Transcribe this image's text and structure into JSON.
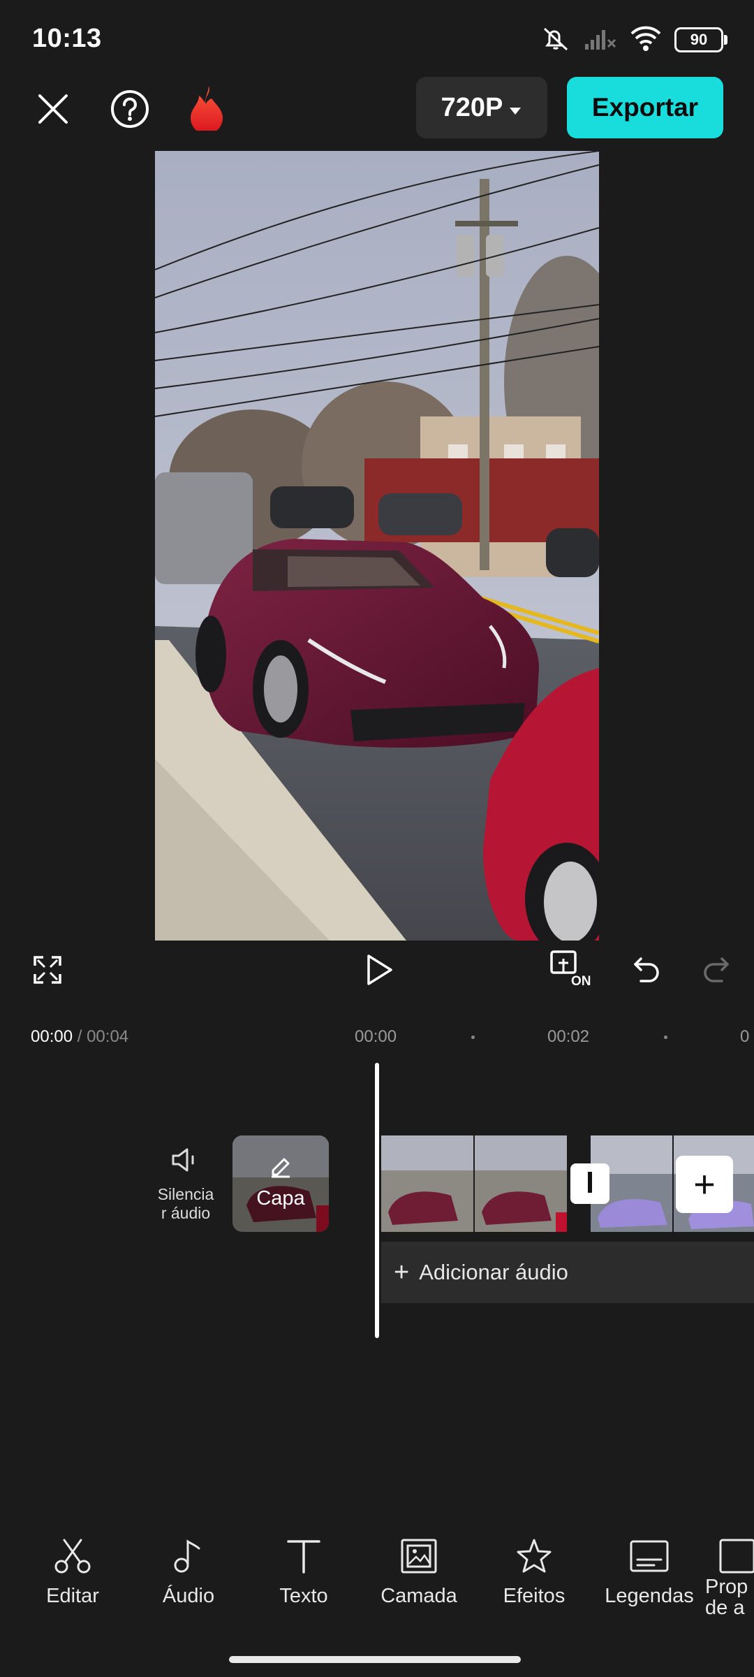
{
  "status_bar": {
    "time": "10:13",
    "battery": "90",
    "icons": [
      "mute-icon",
      "signal-off-icon",
      "wifi-icon",
      "battery-icon"
    ]
  },
  "toolbar": {
    "icons": [
      "close-icon",
      "help-icon",
      "fire-icon"
    ],
    "resolution": "720P",
    "export_label": "Exportar",
    "accent_color": "#19dcdc"
  },
  "playback": {
    "current_time": "00:00",
    "separator": " / ",
    "total_time": "00:04",
    "controls": [
      "fullscreen-icon",
      "play-icon",
      "preview-on-icon",
      "undo-icon",
      "redo-icon"
    ],
    "preview_on_label": "ON"
  },
  "timeline": {
    "ruler": [
      "00:00",
      "00:02",
      "0"
    ],
    "mute_label_line1": "Silencia",
    "mute_label_line2": "r áudio",
    "cover_label": "Capa",
    "add_audio_label": "Adicionar áudio"
  },
  "bottom_toolbar": {
    "tools": [
      {
        "label": "Editar",
        "icon": "scissors-icon"
      },
      {
        "label": "Áudio",
        "icon": "music-note-icon"
      },
      {
        "label": "Texto",
        "icon": "text-icon"
      },
      {
        "label": "Camada",
        "icon": "overlay-icon"
      },
      {
        "label": "Efeitos",
        "icon": "effects-star-icon"
      },
      {
        "label": "Legendas",
        "icon": "captions-icon"
      },
      {
        "label_line1": "Prop",
        "label_line2": "de a",
        "icon": "aspect-ratio-icon"
      }
    ]
  }
}
